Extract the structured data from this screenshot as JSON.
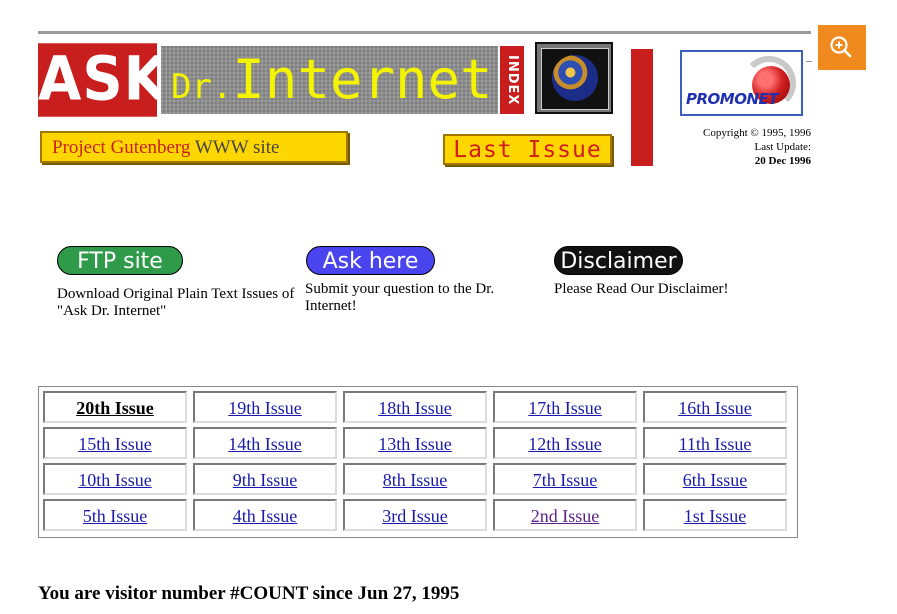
{
  "logo": {
    "ask": "ASK",
    "dr": "Dr.",
    "internet": "Internet",
    "index": "INDEX"
  },
  "buttons": {
    "project_gutenberg_prefix": "Project Gutenberg",
    "project_gutenberg_suffix": " WWW site",
    "last_issue": "Last Issue"
  },
  "promonet": {
    "logo_text": "PROMONET",
    "copyright": "Copyright © 1995, 1996",
    "last_update_label": "Last Update:",
    "last_update_date": "20 Dec 1996"
  },
  "icons": {
    "zoom": "zoom-in-icon",
    "globe": "globe-icon"
  },
  "nav": [
    {
      "label": "FTP site",
      "description": "Download Original Plain Text Issues of \"Ask Dr. Internet\"",
      "color": "#2f9a4a"
    },
    {
      "label": "Ask here",
      "description": "Submit your question to the Dr. Internet!",
      "color": "#4a44ef"
    },
    {
      "label": "Disclaimer",
      "description": "Please Read Our Disclaimer!",
      "color": "#111111"
    }
  ],
  "issues": [
    [
      "20th Issue",
      "19th Issue",
      "18th Issue",
      "17th Issue",
      "16th Issue"
    ],
    [
      "15th Issue",
      "14th Issue",
      "13th Issue",
      "12th Issue",
      "11th Issue"
    ],
    [
      "10th Issue",
      "9th Issue",
      "8th Issue",
      "7th Issue",
      "6th Issue"
    ],
    [
      "5th Issue",
      "4th Issue",
      "3rd Issue",
      "2nd Issue",
      "1st Issue"
    ]
  ],
  "visitor": "You are visitor number #COUNT since Jun 27, 1995",
  "colors": {
    "link": "#1a1aaa",
    "visited_link": "#5a1f8a",
    "banner_red": "#c81e1e",
    "gold": "#ffd700",
    "zoom_orange": "#f08a1e"
  }
}
